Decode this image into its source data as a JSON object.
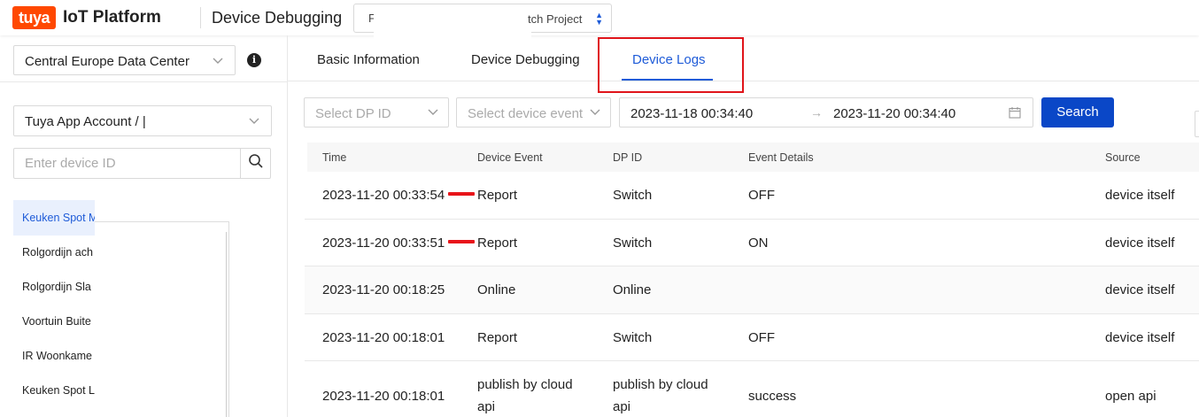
{
  "header": {
    "logo_brand": "tuya",
    "logo_text": "IoT Platform",
    "title": "Device Debugging",
    "project_prefix": "F",
    "project_value": "tch Project"
  },
  "sidebar": {
    "data_center": "Central Europe Data Center",
    "account_select": "Tuya App Account / |",
    "device_id_placeholder": "Enter device ID",
    "devices": [
      {
        "label": "Keuken Spot M",
        "active": true
      },
      {
        "label": "Rolgordijn ach",
        "active": false
      },
      {
        "label": "Rolgordijn Sla",
        "active": false
      },
      {
        "label": "Voortuin Buite",
        "active": false
      },
      {
        "label": "IR Woonkame",
        "active": false
      },
      {
        "label": "Keuken Spot L",
        "active": false
      }
    ]
  },
  "tabs": [
    {
      "label": "Basic Information",
      "active": false
    },
    {
      "label": "Device Debugging",
      "active": false
    },
    {
      "label": "Device Logs",
      "active": true
    }
  ],
  "filters": {
    "dp_placeholder": "Select DP ID",
    "event_placeholder": "Select device event",
    "start_time": "2023-11-18 00:34:40",
    "end_time": "2023-11-20 00:34:40",
    "search_label": "Search"
  },
  "table": {
    "columns": [
      "Time",
      "Device Event",
      "DP ID",
      "Event Details",
      "Source"
    ],
    "rows": [
      {
        "time": "2023-11-20 00:33:54",
        "event": "Report",
        "dp": "Switch",
        "details": "OFF",
        "source": "device itself"
      },
      {
        "time": "2023-11-20 00:33:51",
        "event": "Report",
        "dp": "Switch",
        "details": "ON",
        "source": "device itself"
      },
      {
        "time": "2023-11-20 00:18:25",
        "event": "Online",
        "dp": "Online",
        "details": "",
        "source": "device itself"
      },
      {
        "time": "2023-11-20 00:18:01",
        "event": "Report",
        "dp": "Switch",
        "details": "OFF",
        "source": "device itself"
      },
      {
        "time": "2023-11-20 00:18:01",
        "event": "publish by cloud api",
        "dp": "publish by cloud api",
        "details": "success",
        "source": "open api"
      }
    ]
  },
  "colors": {
    "accent": "#1e5bd8",
    "brand": "#ff4800",
    "highlight": "#e0141a",
    "button": "#0a47c7"
  }
}
